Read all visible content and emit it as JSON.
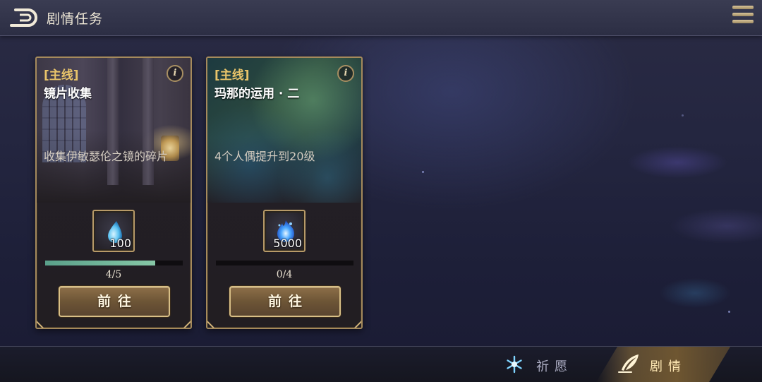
{
  "header": {
    "title": "剧情任务",
    "back_icon": "back-arrow-icon",
    "menu_icon": "hamburger-menu-icon"
  },
  "quests": [
    {
      "tag": "[主线]",
      "title": "镜片收集",
      "description": "收集伊敏瑟伦之镜的碎片",
      "reward_icon": "water-drop-icon",
      "reward_count": "100",
      "progress_current": 4,
      "progress_total": 5,
      "progress_text": "4/5",
      "button_label": "前往",
      "info_label": "i"
    },
    {
      "tag": "[主线]",
      "title": "玛那的运用 · 二",
      "description": "4个人偶提升到20级",
      "reward_icon": "blue-flame-icon",
      "reward_count": "5000",
      "progress_current": 0,
      "progress_total": 4,
      "progress_text": "0/4",
      "button_label": "前往",
      "info_label": "i"
    }
  ],
  "bottom_nav": {
    "wish_label": "祈愿",
    "story_label": "剧情",
    "wish_icon": "snowflake-icon",
    "story_icon": "quill-icon",
    "active": "story"
  },
  "colors": {
    "accent_gold": "#e9c46a",
    "progress_green": "#86c7a6",
    "button_brown": "#6d5536"
  }
}
